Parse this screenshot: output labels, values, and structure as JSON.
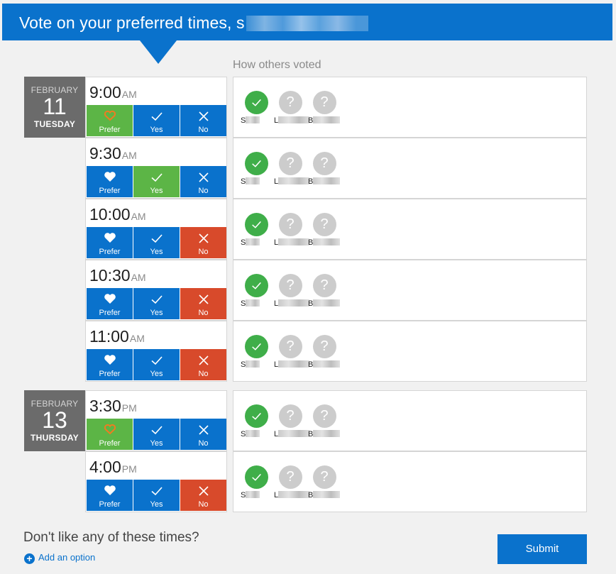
{
  "header": {
    "title": "Vote on your preferred times, s"
  },
  "others_heading": "How others voted",
  "dates": [
    {
      "month": "FEBRUARY",
      "day": "11",
      "weekday": "TUESDAY"
    },
    {
      "month": "FEBRUARY",
      "day": "13",
      "weekday": "THURSDAY"
    }
  ],
  "buttons": {
    "prefer": "Prefer",
    "yes": "Yes",
    "no": "No"
  },
  "slots": [
    {
      "time": "9:00",
      "ampm": "AM",
      "date_index": 0,
      "vote": "prefer"
    },
    {
      "time": "9:30",
      "ampm": "AM",
      "date_index": 0,
      "vote": "yes"
    },
    {
      "time": "10:00",
      "ampm": "AM",
      "date_index": 0,
      "vote": "no"
    },
    {
      "time": "10:30",
      "ampm": "AM",
      "date_index": 0,
      "vote": "no"
    },
    {
      "time": "11:00",
      "ampm": "AM",
      "date_index": 0,
      "vote": "no"
    },
    {
      "time": "3:30",
      "ampm": "PM",
      "date_index": 1,
      "vote": "prefer"
    },
    {
      "time": "4:00",
      "ampm": "PM",
      "date_index": 1,
      "vote": "no"
    }
  ],
  "voters": [
    {
      "initial": "S",
      "status": "yes"
    },
    {
      "initial": "L",
      "status": "unknown"
    },
    {
      "initial": "B",
      "status": "unknown"
    }
  ],
  "footer": {
    "question": "Don't like any of these times?",
    "add_option": "Add an option",
    "submit": "Submit"
  },
  "colors": {
    "brand_blue": "#0a72cc",
    "green": "#5cb546",
    "red": "#d84a2b",
    "prefer_heart": "#f07b21"
  }
}
